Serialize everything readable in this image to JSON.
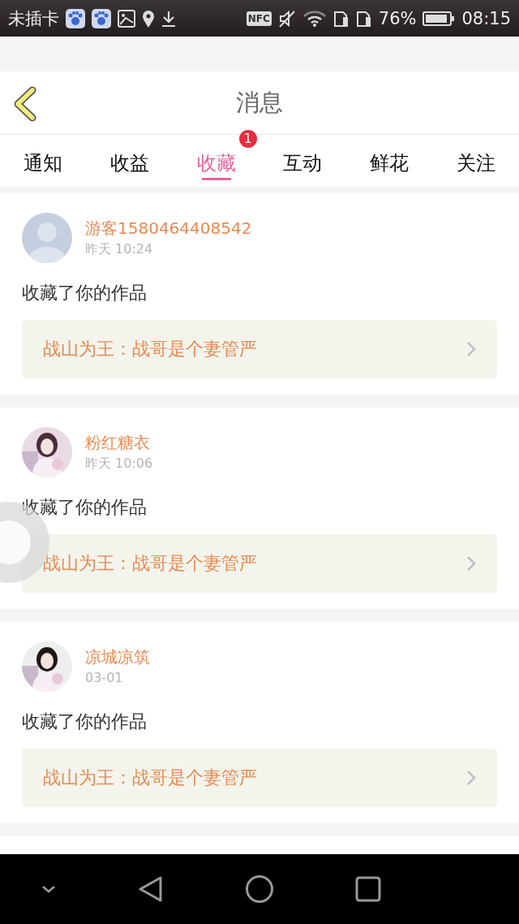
{
  "status_bar": {
    "carrier": "未插卡",
    "nfc": "NFC",
    "battery": "76%",
    "time": "08:15"
  },
  "header": {
    "title": "消息"
  },
  "tabs": [
    {
      "label": "通知",
      "selected": false
    },
    {
      "label": "收益",
      "selected": false
    },
    {
      "label": "收藏",
      "selected": true,
      "badge": "1"
    },
    {
      "label": "互动",
      "selected": false
    },
    {
      "label": "鲜花",
      "selected": false
    },
    {
      "label": "关注",
      "selected": false
    }
  ],
  "messages": [
    {
      "kind": "default",
      "name": "游客1580464408542",
      "time": "昨天 10:24",
      "text": "收藏了你的作品",
      "work": "战山为王：战哥是个妻管严"
    },
    {
      "kind": "picture",
      "name": "粉红糖衣",
      "time": "昨天 10:06",
      "text": "收藏了你的作品",
      "work": "战山为王：战哥是个妻管严"
    },
    {
      "kind": "picture",
      "name": "凉城凉筑",
      "time": "03-01",
      "text": "收藏了你的作品",
      "work": "战山为王：战哥是个妻管严"
    }
  ]
}
